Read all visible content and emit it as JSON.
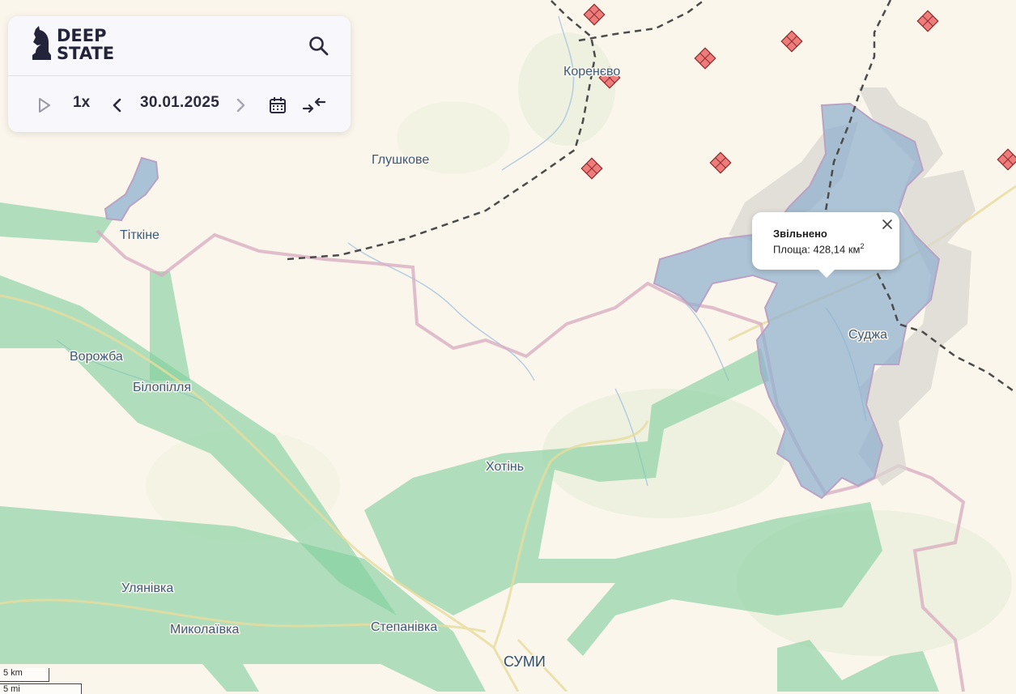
{
  "app": {
    "logo_line1": "DEEP",
    "logo_line2": "STATE"
  },
  "controls": {
    "speed": "1x",
    "date": "30.01.2025"
  },
  "icons": [
    "search-icon",
    "play-icon",
    "chevron-left-icon",
    "chevron-right-icon",
    "calendar-icon",
    "collapse-arrows-icon",
    "close-icon"
  ],
  "popup": {
    "title": "Звільнено",
    "area_label": "Площа:",
    "area_value": "428,14",
    "area_unit": "км",
    "area_unit_power": "2"
  },
  "places": [
    {
      "id": "korenevo",
      "name": "Коренєво"
    },
    {
      "id": "glushkove",
      "name": "Глушкове"
    },
    {
      "id": "titkine",
      "name": "Тіткіне"
    },
    {
      "id": "vorozhba",
      "name": "Ворожба"
    },
    {
      "id": "bilopillia",
      "name": "Білопілля"
    },
    {
      "id": "khotin",
      "name": "Хотінь"
    },
    {
      "id": "sudzha",
      "name": "Суджа"
    },
    {
      "id": "ulianivka",
      "name": "Улянівка"
    },
    {
      "id": "mykolaivka",
      "name": "Миколаївка"
    },
    {
      "id": "stepanivka",
      "name": "Степанівка"
    },
    {
      "id": "sumy",
      "name": "СУМИ"
    }
  ],
  "scale": {
    "km": "5 km",
    "mi": "5 mi"
  },
  "colors": {
    "background": "#fbf6ec",
    "liberated_area": "#8fb0cf",
    "gray_zone": "#d9d6d2",
    "green_band": "#7fcf9c",
    "border": "#d7a9bf",
    "marker": "#ef7b7b"
  }
}
